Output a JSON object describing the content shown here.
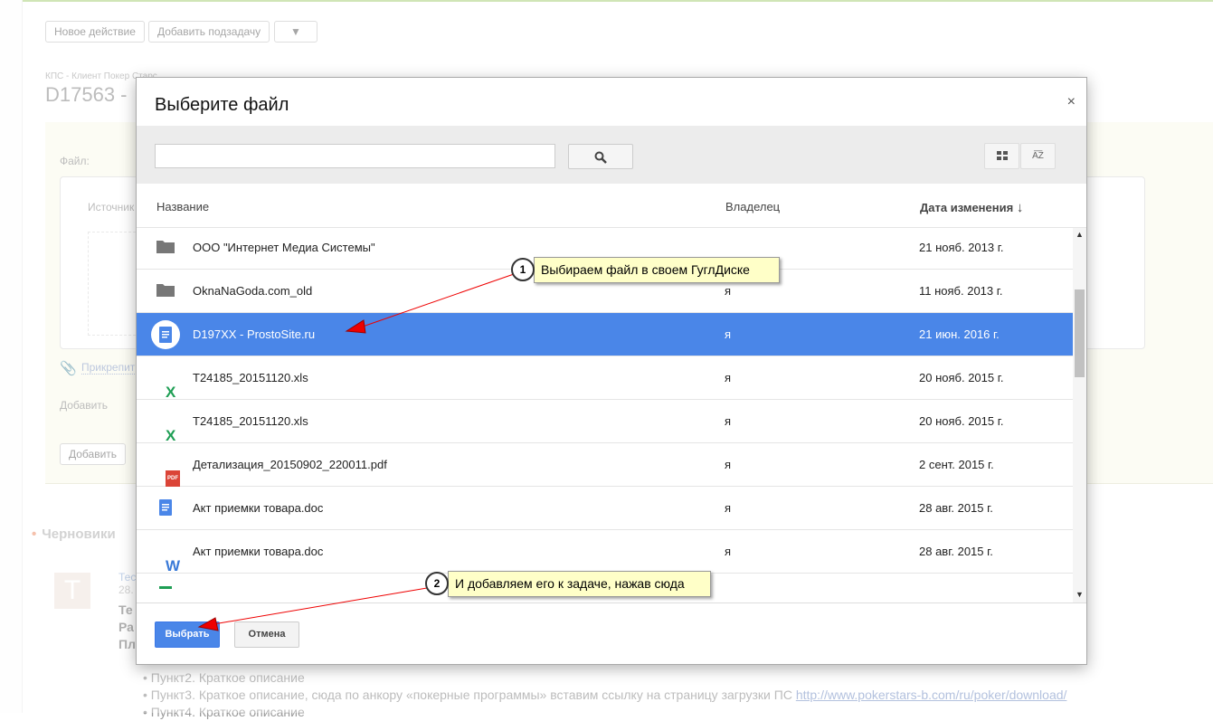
{
  "toolbar": {
    "new_action": "Новое действие",
    "add_subtask": "Добавить подзадачу",
    "more": "▼"
  },
  "page": {
    "breadcrumb": "КПС - Клиент Покер Старс",
    "title": "D17563 -",
    "file_label": "Файл:",
    "source_label": "Источник",
    "attach_link": "Прикрепит",
    "add_label": "Добавить",
    "add_button": "Добавить",
    "drafts": "Черновики",
    "avatar_letter": "T",
    "draft_author": "Тес",
    "draft_date": "28.",
    "draft_lines": [
      "Те",
      "Ра",
      "Пл"
    ],
    "bullets": [
      "Пункт2. Краткое описание",
      "Пункт3. Краткое описание, сюда по анкору «покерные программы» вставим ссылку на страницу загрузки ПС ",
      "Пункт4. Краткое описание"
    ],
    "link": "http://www.pokerstars-b.com/ru/poker/download/"
  },
  "dialog": {
    "title": "Выберите файл",
    "close": "×",
    "search_value": "",
    "columns": {
      "name": "Название",
      "owner": "Владелец",
      "modified": "Дата изменения"
    },
    "files": [
      {
        "icon": "folder",
        "name": "ООО \"Интернет Медиа Системы\"",
        "owner": "",
        "date": "21 нояб. 2013 г."
      },
      {
        "icon": "folder",
        "name": "OknaNaGoda.com_old",
        "owner": "я",
        "date": "11 нояб. 2013 г."
      },
      {
        "icon": "gdoc",
        "name": "D197XX - ProstoSite.ru",
        "owner": "я",
        "date": "21 июн. 2016 г.",
        "selected": true
      },
      {
        "icon": "xls",
        "name": "T24185_20151120.xls",
        "owner": "я",
        "date": "20 нояб. 2015 г."
      },
      {
        "icon": "xls",
        "name": "T24185_20151120.xls",
        "owner": "я",
        "date": "20 нояб. 2015 г."
      },
      {
        "icon": "pdf",
        "name": "Детализация_20150902_220011.pdf",
        "owner": "я",
        "date": "2 сент. 2015 г."
      },
      {
        "icon": "gdoc",
        "name": "Акт приемки товара.doc",
        "owner": "я",
        "date": "28 авг. 2015 г."
      },
      {
        "icon": "word",
        "name": "Акт приемки товара.doc",
        "owner": "я",
        "date": "28 авг. 2015 г."
      }
    ],
    "select_button": "Выбрать",
    "cancel_button": "Отмена"
  },
  "callouts": [
    {
      "num": "1",
      "text": "Выбираем файл в своем ГуглДиске"
    },
    {
      "num": "2",
      "text": "И добавляем его к задаче, нажав сюда"
    }
  ],
  "colors": {
    "accent": "#4a86e8",
    "callout": "#ffffc8",
    "arrow": "#ff0000"
  }
}
